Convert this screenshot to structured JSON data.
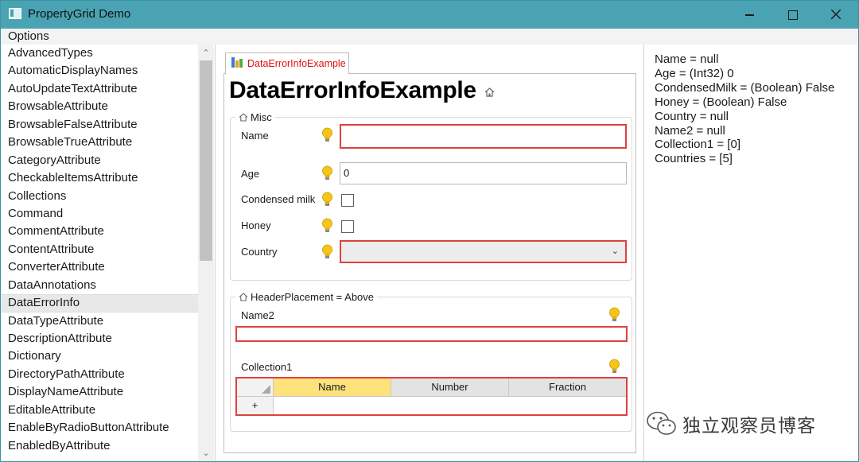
{
  "window": {
    "title": "PropertyGrid Demo"
  },
  "menu": {
    "options_label": "Options"
  },
  "sidebar": {
    "items": [
      "AdvancedTypes",
      "AutomaticDisplayNames",
      "AutoUpdateTextAttribute",
      "BrowsableAttribute",
      "BrowsableFalseAttribute",
      "BrowsableTrueAttribute",
      "CategoryAttribute",
      "CheckableItemsAttribute",
      "Collections",
      "Command",
      "CommentAttribute",
      "ContentAttribute",
      "ConverterAttribute",
      "DataAnnotations",
      "DataErrorInfo",
      "DataTypeAttribute",
      "DescriptionAttribute",
      "Dictionary",
      "DirectoryPathAttribute",
      "DisplayNameAttribute",
      "EditableAttribute",
      "EnableByRadioButtonAttribute",
      "EnabledByAttribute"
    ],
    "selected": "DataErrorInfo"
  },
  "tab": {
    "label": "DataErrorInfoExample"
  },
  "page_title": "DataErrorInfoExample",
  "misc_group": {
    "header": "Misc",
    "name_label": "Name",
    "name_value": "",
    "age_label": "Age",
    "age_value": "0",
    "condensed_label": "Condensed milk",
    "honey_label": "Honey",
    "country_label": "Country"
  },
  "header_group": {
    "header": "HeaderPlacement = Above",
    "name2_label": "Name2",
    "name2_value": "",
    "collection_label": "Collection1",
    "columns": [
      "Name",
      "Number",
      "Fraction"
    ],
    "add_row_label": "+"
  },
  "output_lines": [
    "Name = null",
    "Age = (Int32) 0",
    "CondensedMilk = (Boolean) False",
    "Honey = (Boolean) False",
    "Country = null",
    "Name2 = null",
    "Collection1 = [0]",
    "Countries = [5]"
  ],
  "watermark": {
    "text": "独立观察员博客"
  },
  "colors": {
    "titlebar": "#4aa3b3",
    "error_border": "#e04040",
    "tab_label": "#e01010",
    "column_highlight": "#fde17a"
  }
}
